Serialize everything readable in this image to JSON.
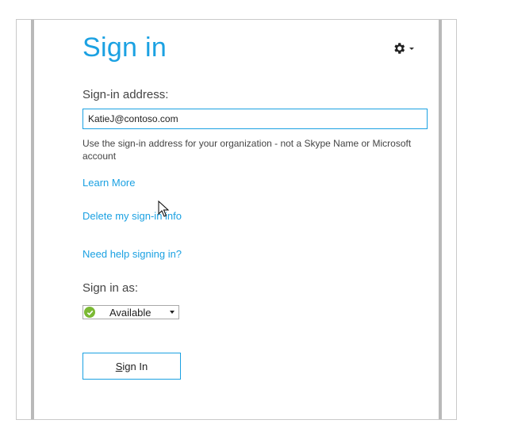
{
  "window": {
    "title": "Sign in"
  },
  "settings": {
    "icon": "gear-icon"
  },
  "address": {
    "label": "Sign-in address:",
    "value": "KatieJ@contoso.com",
    "hint": "Use the sign-in address for your organization - not a Skype Name or Microsoft account"
  },
  "links": {
    "learn_more": "Learn More",
    "delete_info": "Delete my sign-in info",
    "need_help": "Need help signing in?"
  },
  "status": {
    "label": "Sign in as:",
    "selected": "Available",
    "color": "#7bb934"
  },
  "actions": {
    "signin_underlined": "S",
    "signin_rest": "ign In"
  },
  "colors": {
    "accent": "#1ba1e2"
  }
}
